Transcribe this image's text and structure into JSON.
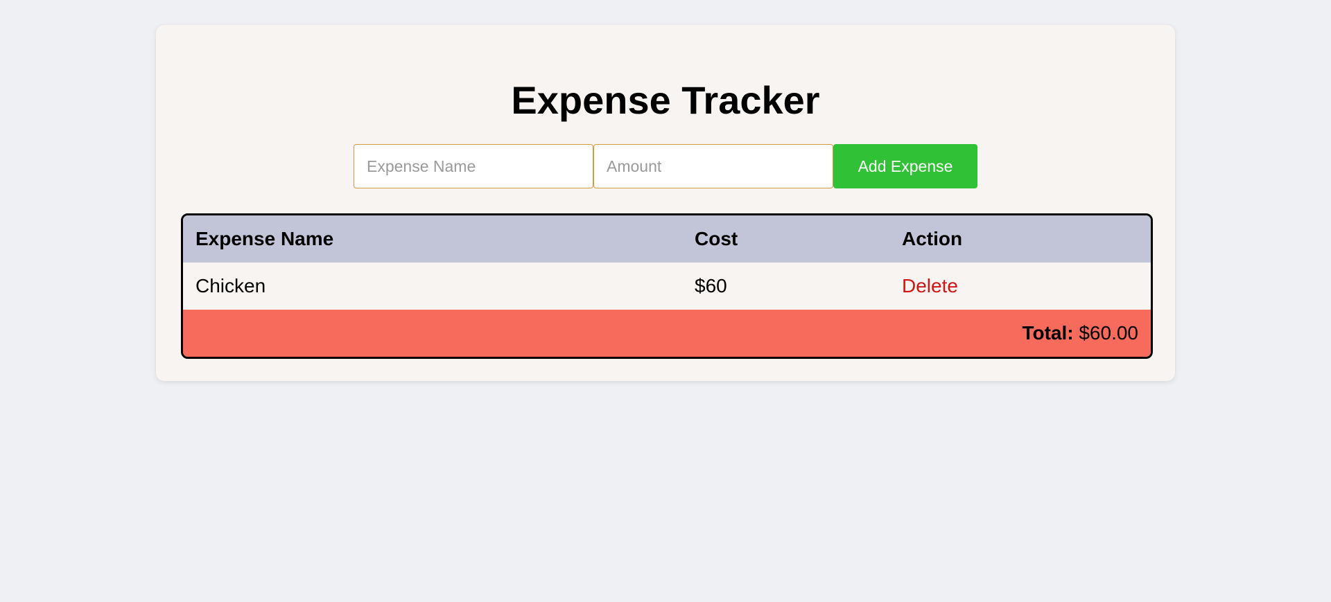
{
  "app": {
    "title": "Expense Tracker"
  },
  "form": {
    "name_placeholder": "Expense Name",
    "name_value": "",
    "amount_placeholder": "Amount",
    "amount_value": "",
    "add_label": "Add Expense"
  },
  "table": {
    "headers": {
      "name": "Expense Name",
      "cost": "Cost",
      "action": "Action"
    },
    "rows": [
      {
        "name": "Chicken",
        "cost": "$60",
        "action": "Delete"
      }
    ],
    "total_label": "Total:",
    "total_value": "$60.00"
  },
  "colors": {
    "background": "#eef0f4",
    "card": "#f7f4f1",
    "header_row": "#c2c5d7",
    "total_row": "#f66b5c",
    "add_button": "#31c136",
    "delete_text": "#d01515",
    "input_border": "#d49a3c"
  }
}
